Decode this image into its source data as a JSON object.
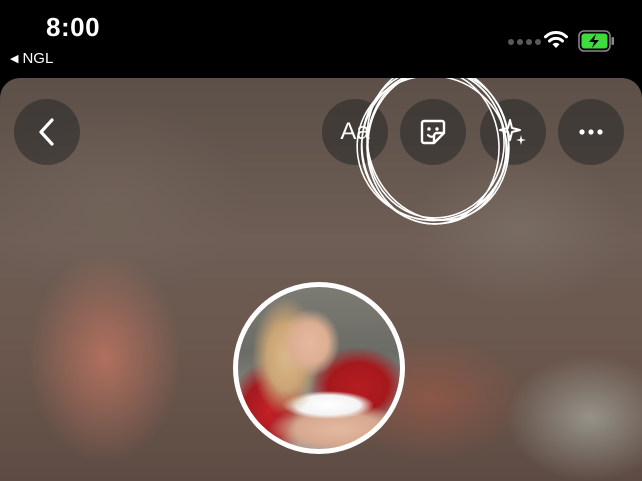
{
  "status_bar": {
    "time": "8:00",
    "back_app": "NGL"
  },
  "toolbar": {
    "text_tool_label": "Aa"
  },
  "colors": {
    "battery_fill": "#3ddc3d",
    "scribble": "#ffffff"
  },
  "icons": [
    "chevron-left-icon",
    "sticker-icon",
    "sparkles-icon",
    "more-icon",
    "wifi-icon",
    "battery-charging-icon"
  ]
}
